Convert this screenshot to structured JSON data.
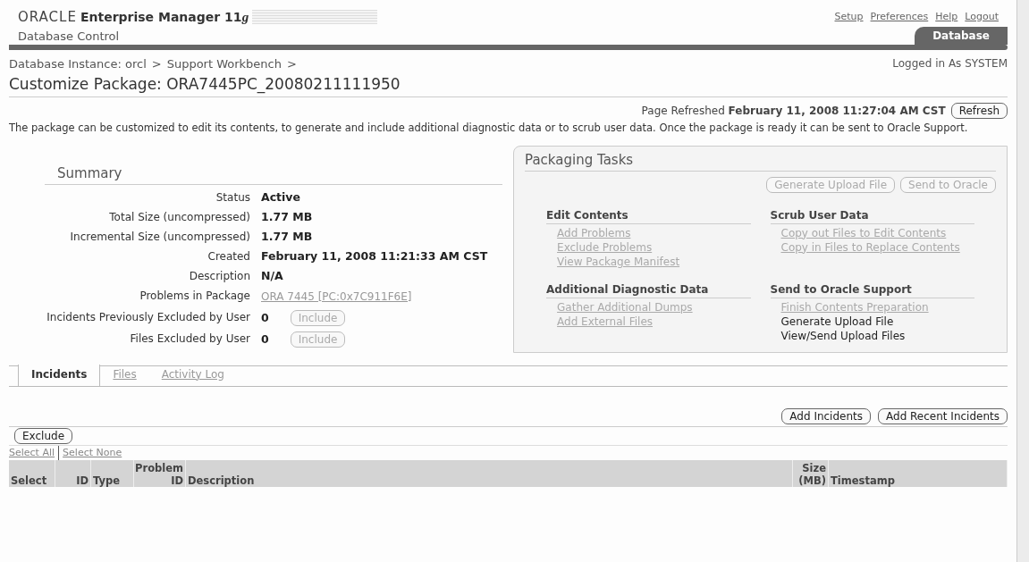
{
  "header": {
    "brand": "ORACLE",
    "product": "Enterprise Manager 11",
    "version": "g",
    "subtitle": "Database Control",
    "global_links": [
      "Setup",
      "Preferences",
      "Help",
      "Logout"
    ],
    "tabs": [
      {
        "label": "Database",
        "selected": true
      }
    ]
  },
  "breadcrumbs": {
    "items": [
      "Database Instance: orcl",
      "Support Workbench"
    ],
    "separator": ">"
  },
  "login": "Logged in As SYSTEM",
  "page_title": "Customize Package: ORA7445PC_20080211111950",
  "refresh": {
    "label": "Page Refreshed",
    "time": "February 11, 2008 11:27:04 AM CST",
    "button": "Refresh"
  },
  "intro": "The package can be customized to edit its contents, to generate and include additional diagnostic data or to scrub user data. Once the package is ready it can be sent to Oracle Support.",
  "summary": {
    "title": "Summary",
    "rows": [
      {
        "kind": "text",
        "label": "Status",
        "value": "Active"
      },
      {
        "kind": "text",
        "label": "Total Size (uncompressed)",
        "value": "1.77 MB"
      },
      {
        "kind": "text",
        "label": "Incremental Size (uncompressed)",
        "value": "1.77 MB"
      },
      {
        "kind": "text",
        "label": "Created",
        "value": "February 11, 2008 11:21:33 AM CST"
      },
      {
        "kind": "text",
        "label": "Description",
        "value": "N/A"
      },
      {
        "kind": "link",
        "label": "Problems in Package",
        "value": "ORA 7445 [PC:0x7C911F6E]"
      },
      {
        "kind": "action",
        "label": "Incidents Previously Excluded by User",
        "value": "0",
        "button": "Include",
        "disabled": true
      },
      {
        "kind": "action",
        "label": "Files Excluded by User",
        "value": "0",
        "button": "Include",
        "disabled": true
      }
    ]
  },
  "packaging": {
    "title": "Packaging Tasks",
    "buttons": [
      {
        "label": "Generate Upload File",
        "disabled": true
      },
      {
        "label": "Send to Oracle",
        "disabled": true
      }
    ],
    "sections": [
      {
        "title": "Edit Contents",
        "links": [
          {
            "label": "Add Problems",
            "disabled": true
          },
          {
            "label": "Exclude Problems",
            "disabled": true
          },
          {
            "label": "View Package Manifest",
            "disabled": true
          }
        ]
      },
      {
        "title": "Scrub User Data",
        "links": [
          {
            "label": "Copy out Files to Edit Contents",
            "disabled": true
          },
          {
            "label": "Copy in Files to Replace Contents",
            "disabled": true
          }
        ]
      },
      {
        "title": "Additional Diagnostic Data",
        "links": [
          {
            "label": "Gather Additional Dumps",
            "disabled": true
          },
          {
            "label": "Add External Files",
            "disabled": true
          }
        ]
      },
      {
        "title": "Send to Oracle Support",
        "links": [
          {
            "label": "Finish Contents Preparation",
            "disabled": true
          },
          {
            "label": "Generate Upload File",
            "disabled": false
          },
          {
            "label": "View/Send Upload Files",
            "disabled": false
          }
        ]
      }
    ]
  },
  "tabs": [
    {
      "label": "Incidents",
      "selected": true
    },
    {
      "label": "Files",
      "selected": false
    },
    {
      "label": "Activity Log",
      "selected": false
    }
  ],
  "actions": [
    "Add Incidents",
    "Add Recent Incidents"
  ],
  "table": {
    "buttons": [
      "Exclude"
    ],
    "select_links": [
      "Select All",
      "Select None"
    ],
    "columns": [
      "Select",
      "ID",
      "Type",
      "Problem\nID",
      "Description",
      "Size\n(MB)",
      "Timestamp"
    ]
  }
}
